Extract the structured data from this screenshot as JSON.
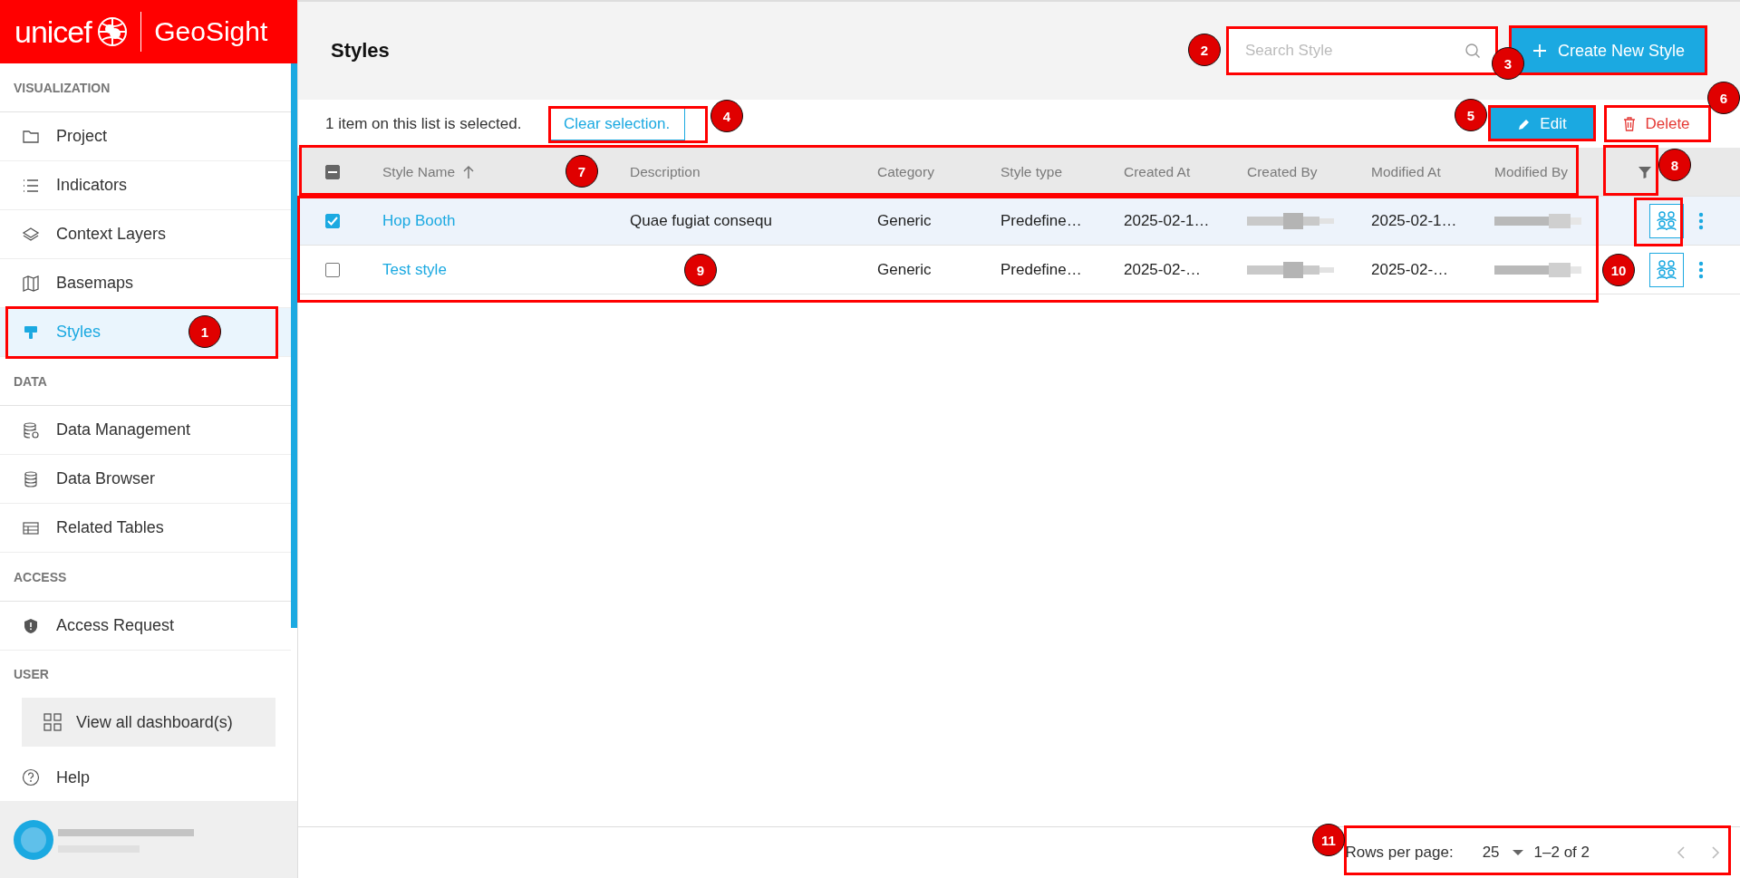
{
  "logo": {
    "brand": "unicef",
    "product": "GeoSight"
  },
  "sidebar": {
    "sections": [
      {
        "heading": "VISUALIZATION",
        "items": [
          {
            "label": "Project",
            "selected": false
          },
          {
            "label": "Indicators",
            "selected": false
          },
          {
            "label": "Context Layers",
            "selected": false
          },
          {
            "label": "Basemaps",
            "selected": false
          },
          {
            "label": "Styles",
            "selected": true
          }
        ]
      },
      {
        "heading": "DATA",
        "items": [
          {
            "label": "Data Management",
            "selected": false
          },
          {
            "label": "Data Browser",
            "selected": false
          },
          {
            "label": "Related Tables",
            "selected": false
          }
        ]
      },
      {
        "heading": "ACCESS",
        "items": [
          {
            "label": "Access Request",
            "selected": false
          }
        ]
      },
      {
        "heading": "USER"
      }
    ],
    "dashboards_button": "View all dashboard(s)",
    "help": "Help"
  },
  "page": {
    "title": "Styles",
    "search": {
      "placeholder": "Search Style"
    },
    "create_button": "Create New Style"
  },
  "selection_bar": {
    "message": "1 item on this list is selected.",
    "clear_button": "Clear selection.",
    "edit_button": "Edit",
    "delete_button": "Delete"
  },
  "table": {
    "header_checkbox": {
      "indeterminate": true
    },
    "columns": [
      {
        "label": "Style Name",
        "sorted_ascending": true
      },
      {
        "label": "Description"
      },
      {
        "label": "Category"
      },
      {
        "label": "Style type"
      },
      {
        "label": "Created At"
      },
      {
        "label": "Created By"
      },
      {
        "label": "Modified At"
      },
      {
        "label": "Modified By"
      }
    ],
    "rows": [
      {
        "selected": true,
        "name": "Hop Booth",
        "description": "Quae fugiat consequ",
        "category": "Generic",
        "style_type": "Predefine…",
        "created_at": "2025-02-1…",
        "modified_at": "2025-02-1…"
      },
      {
        "selected": false,
        "name": "Test style",
        "category": "Generic",
        "style_type": "Predefine…",
        "created_at": "2025-02-…",
        "modified_at": "2025-02-…"
      }
    ]
  },
  "pagination": {
    "label": "Rows per page:",
    "rows_per_page": "25",
    "range": "1–2 of 2"
  },
  "annotations": [
    {
      "number": "1"
    },
    {
      "number": "2"
    },
    {
      "number": "3"
    },
    {
      "number": "4"
    },
    {
      "number": "5"
    },
    {
      "number": "6"
    },
    {
      "number": "7"
    },
    {
      "number": "8"
    },
    {
      "number": "9"
    },
    {
      "number": "10"
    },
    {
      "number": "11"
    }
  ]
}
